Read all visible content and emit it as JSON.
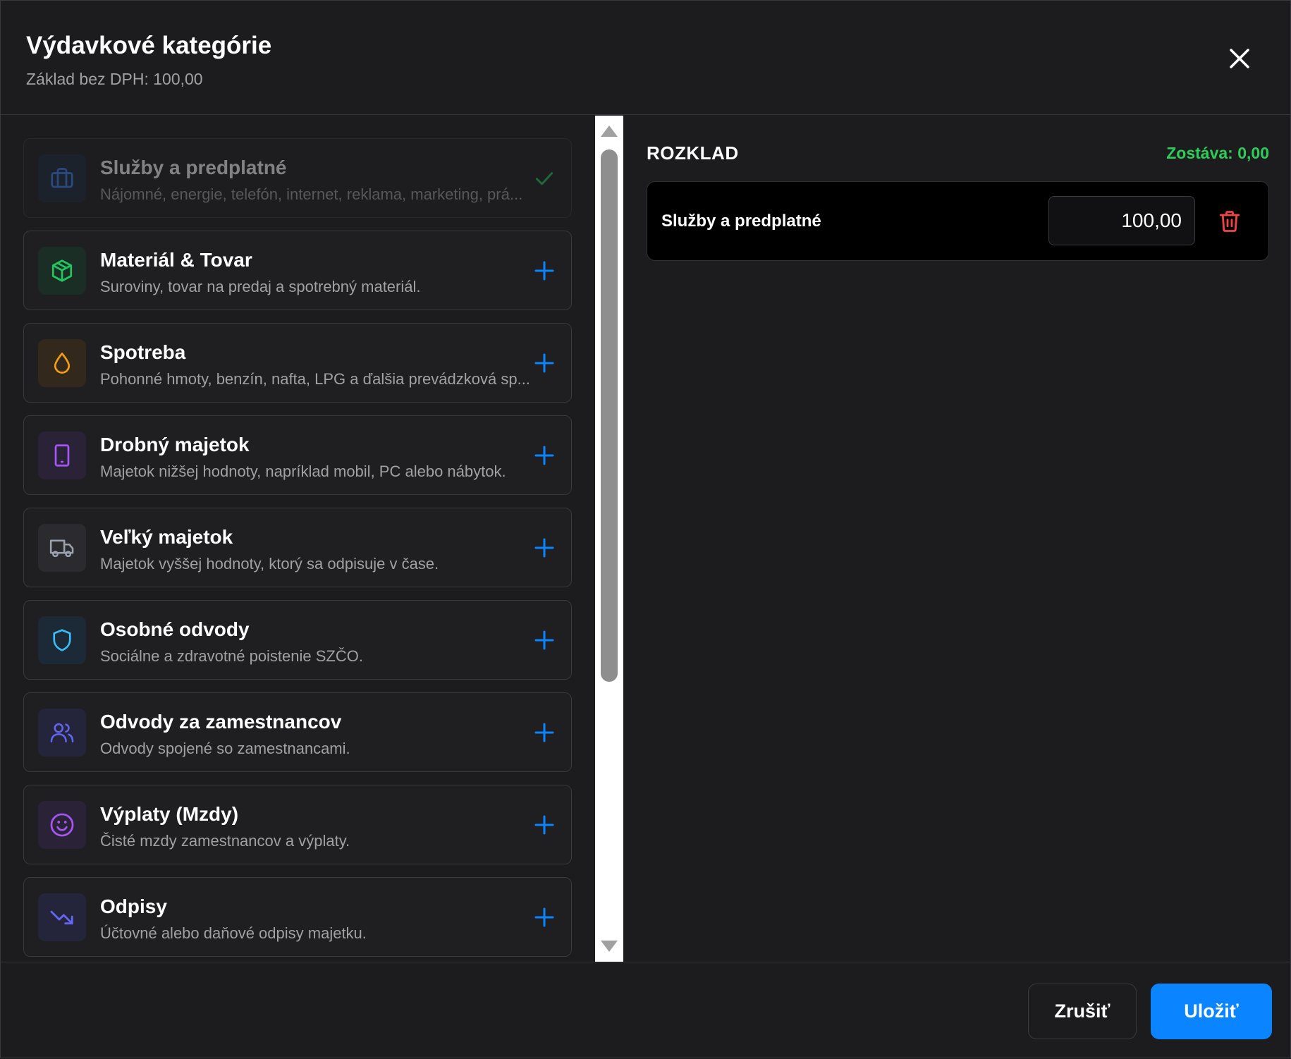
{
  "header": {
    "title": "Výdavkové kategórie",
    "subtitle": "Základ bez DPH: 100,00"
  },
  "categories": [
    {
      "name": "Služby a predplatné",
      "desc": "Nájomné, energie, telefón, internet, reklama, marketing, prá...",
      "icon": "briefcase-icon",
      "color": "#3b82f6",
      "bg": "#1e2a3d",
      "selected": true
    },
    {
      "name": "Materiál & Tovar",
      "desc": "Suroviny, tovar na predaj a spotrebný materiál.",
      "icon": "package-icon",
      "color": "#22c55e",
      "bg": "#1a2e26"
    },
    {
      "name": "Spotreba",
      "desc": "Pohonné hmoty, benzín, nafta, LPG a ďalšia prevádzková sp...",
      "icon": "droplet-icon",
      "color": "#f59e0b",
      "bg": "#33281c"
    },
    {
      "name": "Drobný majetok",
      "desc": "Majetok nižšej hodnoty, napríklad mobil, PC alebo nábytok.",
      "icon": "tablet-icon",
      "color": "#a855f7",
      "bg": "#2a2236"
    },
    {
      "name": "Veľký majetok",
      "desc": "Majetok vyššej hodnoty, ktorý sa odpisuje v čase.",
      "icon": "truck-icon",
      "color": "#9ca3af",
      "bg": "#2b2b2f"
    },
    {
      "name": "Osobné odvody",
      "desc": "Sociálne a zdravotné poistenie SZČO.",
      "icon": "shield-icon",
      "color": "#38bdf8",
      "bg": "#1b2a36"
    },
    {
      "name": "Odvody za zamestnancov",
      "desc": "Odvody spojené so zamestnancami.",
      "icon": "users-icon",
      "color": "#6366f1",
      "bg": "#24253a"
    },
    {
      "name": "Výplaty (Mzdy)",
      "desc": "Čisté mzdy zamestnancov a výplaty.",
      "icon": "smile-icon",
      "color": "#a855f7",
      "bg": "#2a2236"
    },
    {
      "name": "Odpisy",
      "desc": "Účtovné alebo daňové odpisy majetku.",
      "icon": "trending-down-icon",
      "color": "#6366f1",
      "bg": "#24253a"
    }
  ],
  "breakdown": {
    "title": "ROZKLAD",
    "remaining": "Zostáva: 0,00",
    "items": [
      {
        "name": "Služby a predplatné",
        "value": "100,00"
      }
    ]
  },
  "footer": {
    "cancel": "Zrušiť",
    "save": "Uložiť"
  },
  "colors": {
    "accent": "#0a84ff",
    "remaining": "#2ecc59",
    "delete": "#ef4444",
    "check": "#22c55e"
  }
}
